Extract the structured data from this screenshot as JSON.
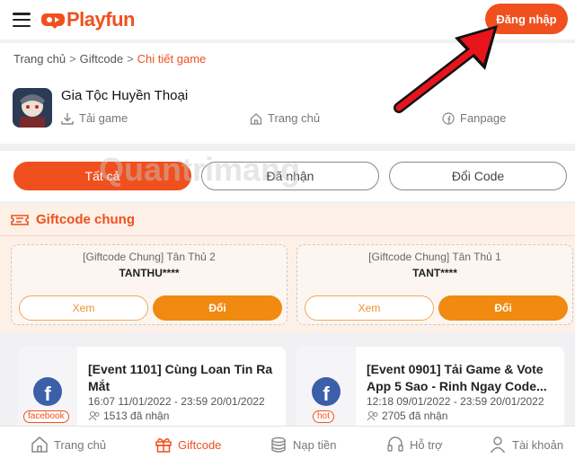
{
  "header": {
    "logo_text": "Playfun",
    "login_label": "Đăng nhập",
    "brand_color": "#f0501e"
  },
  "breadcrumb": {
    "items": [
      "Trang chủ",
      "Giftcode"
    ],
    "current": "Chi tiết game"
  },
  "game": {
    "title": "Gia Tộc Huyền Thoại",
    "links": {
      "download": "Tải game",
      "home": "Trang chủ",
      "fanpage": "Fanpage"
    }
  },
  "tabs": [
    {
      "label": "Tất cả",
      "active": true
    },
    {
      "label": "Đã nhận",
      "active": false
    },
    {
      "label": "Đổi Code",
      "active": false
    }
  ],
  "giftcode_section": {
    "title": "Giftcode chung",
    "cards": [
      {
        "name": "[Giftcode Chung] Tân Thủ 2",
        "code": "TANTHU****",
        "view_label": "Xem",
        "redeem_label": "Đổi"
      },
      {
        "name": "[Giftcode Chung] Tân Thủ 1",
        "code": "TANT****",
        "view_label": "Xem",
        "redeem_label": "Đổi"
      }
    ]
  },
  "events": [
    {
      "title": "[Event 1101] Cùng Loan Tin Ra Mắt",
      "time": "16:07 11/01/2022 - 23:59 20/01/2022",
      "count": "1513 đã nhận",
      "badge": "facebook"
    },
    {
      "title": "[Event 0901] Tải Game & Vote App 5 Sao - Rinh Ngay Code...",
      "time": "12:18 09/01/2022 - 23:59 20/01/2022",
      "count": "2705 đã nhận",
      "badge": "hot"
    }
  ],
  "bottom_nav": [
    {
      "label": "Trang chủ",
      "icon": "home-icon",
      "active": false
    },
    {
      "label": "Giftcode",
      "icon": "gift-icon",
      "active": true
    },
    {
      "label": "Nạp tiền",
      "icon": "coins-icon",
      "active": false
    },
    {
      "label": "Hỗ trợ",
      "icon": "headset-icon",
      "active": false
    },
    {
      "label": "Tài khoản",
      "icon": "user-icon",
      "active": false
    }
  ],
  "watermark": "Quantrimang"
}
